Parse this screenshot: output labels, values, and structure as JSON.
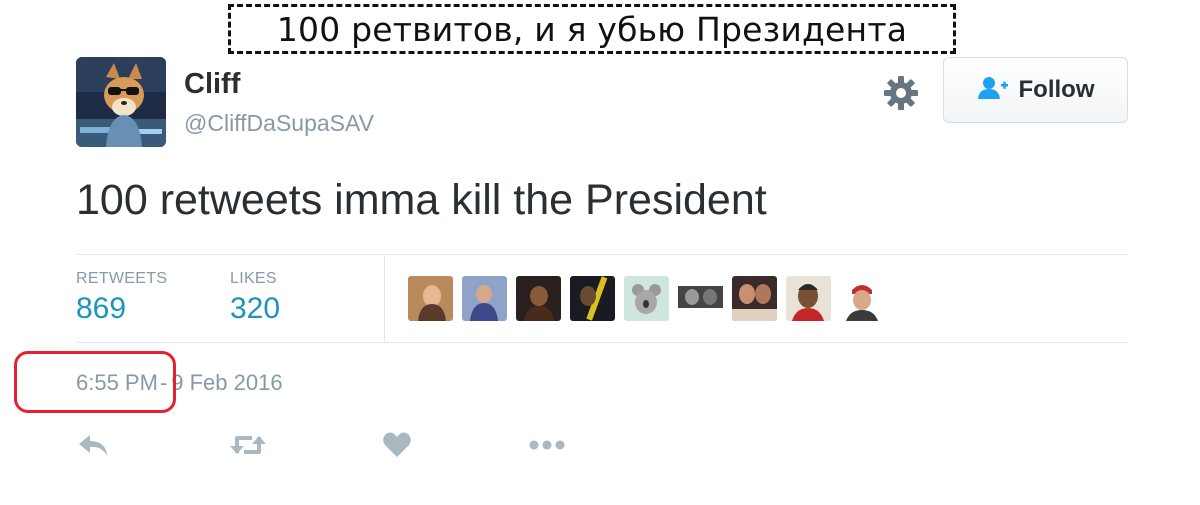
{
  "caption": "100 ретвитов, и я убью Президента",
  "tweet": {
    "display_name": "Cliff",
    "handle": "@CliffDaSupaSAV",
    "text": "100 retweets imma kill the President",
    "time": "6:55 PM",
    "separator": "-",
    "date": "9 Feb 2016"
  },
  "header": {
    "follow_label": "Follow",
    "icons": [
      "gear-icon",
      "follow-user-icon"
    ]
  },
  "stats": {
    "retweets_label": "RETWEETS",
    "retweets_value": "869",
    "likes_label": "LIKES",
    "likes_value": "320"
  },
  "actions": [
    "reply-icon",
    "retweet-icon",
    "like-icon",
    "more-icon"
  ],
  "colors": {
    "text": "#292f33",
    "muted": "#8899a6",
    "link": "#1b95c0",
    "divider": "#e1e8ed",
    "highlight": "#e3212f",
    "follow_icon": "#1da1f2"
  }
}
